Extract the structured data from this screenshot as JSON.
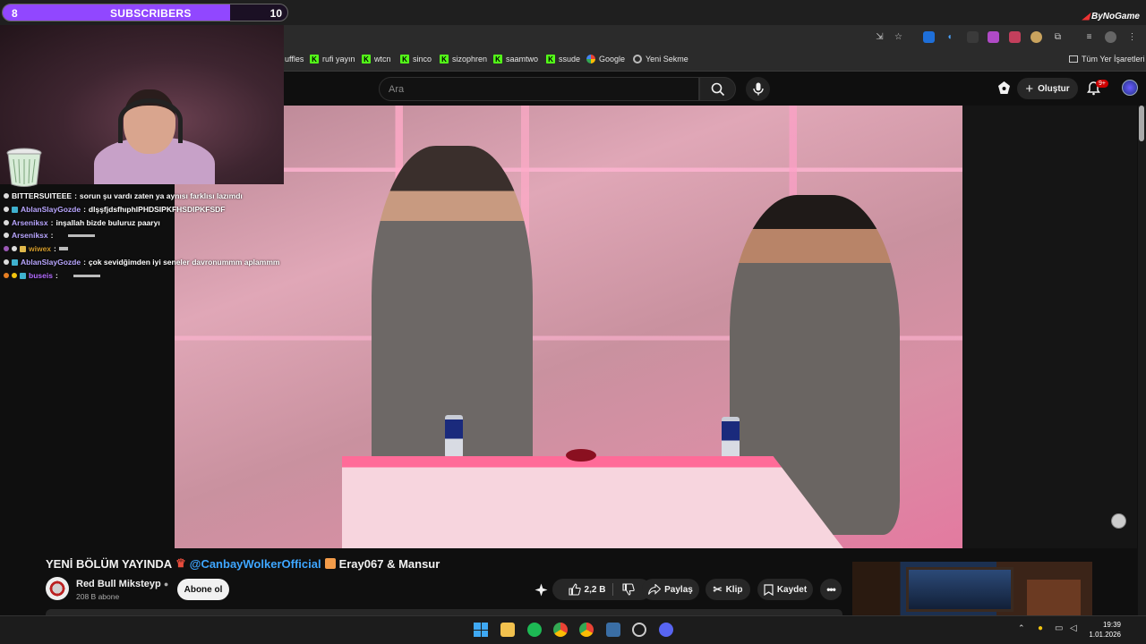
{
  "overlay": {
    "sub_goal": {
      "current": "8",
      "label": "SUBSCRIBERS",
      "goal": "10",
      "progress": 0.8
    },
    "sponsor": "ByNoGame"
  },
  "chat": [
    {
      "user": "BITTERSUITEEE",
      "color": "#ffffff",
      "message": "sorun şu vardı zaten ya aynısı farklısı lazımdı"
    },
    {
      "user": "AblanSlayGozde",
      "color": "#b9a6ff",
      "message": "dlşşfjdsfhıphlPHDSIPKFHSDIPKFSDF"
    },
    {
      "user": "Arseniksx",
      "color": "#b9a6ff",
      "message": "inşallah bizde buluruz paaryı"
    },
    {
      "user": "Arseniksx",
      "color": "#b9a6ff",
      "message": ""
    },
    {
      "user": "wiwex",
      "color": "#d19a2a",
      "message": ""
    },
    {
      "user": "AblanSlayGozde",
      "color": "#b9a6ff",
      "message": "çok sevidğimden iyi seneler davronummm aplammm"
    },
    {
      "user": "buseis",
      "color": "#b36bff",
      "message": ""
    }
  ],
  "bookmarks": [
    {
      "label": "uffles",
      "icon": "none"
    },
    {
      "label": "rufi yayın",
      "icon": "kick"
    },
    {
      "label": "wtcn",
      "icon": "kick"
    },
    {
      "label": "sinco",
      "icon": "kick"
    },
    {
      "label": "sizophren",
      "icon": "kick"
    },
    {
      "label": "saamtwo",
      "icon": "kick"
    },
    {
      "label": "ssude",
      "icon": "kick"
    },
    {
      "label": "Google",
      "icon": "google"
    },
    {
      "label": "Yeni Sekme",
      "icon": "tab"
    }
  ],
  "bookmarks_all": "Tüm Yer İşaretleri",
  "youtube": {
    "search_placeholder": "Ara",
    "create_label": "Oluştur",
    "notifications": "9+"
  },
  "video": {
    "title_prefix": "YENİ BÖLÜM YAYINDA",
    "title_mention": "@CanbayWolkerOfficial",
    "title_suffix": "Eray067 & Mansur",
    "channel_name": "Red Bull Miksteyp",
    "channel_subs": "208 B abone",
    "subscribe_label": "Abone ol",
    "likes": "2,2 B",
    "share_label": "Paylaş",
    "clip_label": "Klip",
    "save_label": "Kaydet"
  },
  "taskbar": {
    "time": "19:39",
    "date": "1.01.2026"
  }
}
